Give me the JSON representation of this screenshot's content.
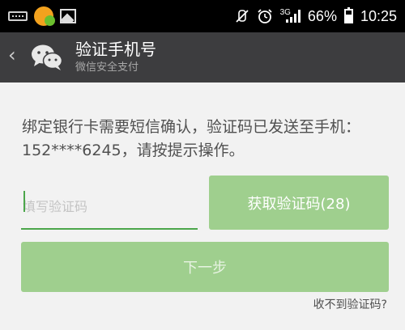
{
  "status_bar": {
    "network": "3G",
    "battery_percent": "66%",
    "battery_level": 0.66,
    "time": "10:25",
    "icons": [
      "keyboard-icon",
      "wechat-notification-icon",
      "image-icon",
      "mute-icon",
      "alarm-icon",
      "signal-icon",
      "battery-icon"
    ]
  },
  "header": {
    "title": "验证手机号",
    "subtitle": "微信安全支付",
    "back_icon": "chevron-left-icon",
    "logo_icon": "wechat-logo-icon"
  },
  "main": {
    "message": "绑定银行卡需要短信确认，验证码已发送至手机：152****6245，请按提示操作。",
    "code_input": {
      "value": "",
      "placeholder": "填写验证码"
    },
    "get_code_button": "获取验证码(28)",
    "next_button": "下一步",
    "help_link": "收不到验证码?"
  },
  "colors": {
    "status_bar": "#000000",
    "title_bar": "#3d3d3f",
    "background": "#f2f2f2",
    "accent_green": "#4ca64b",
    "button_green_disabled": "#9fcf8e"
  }
}
